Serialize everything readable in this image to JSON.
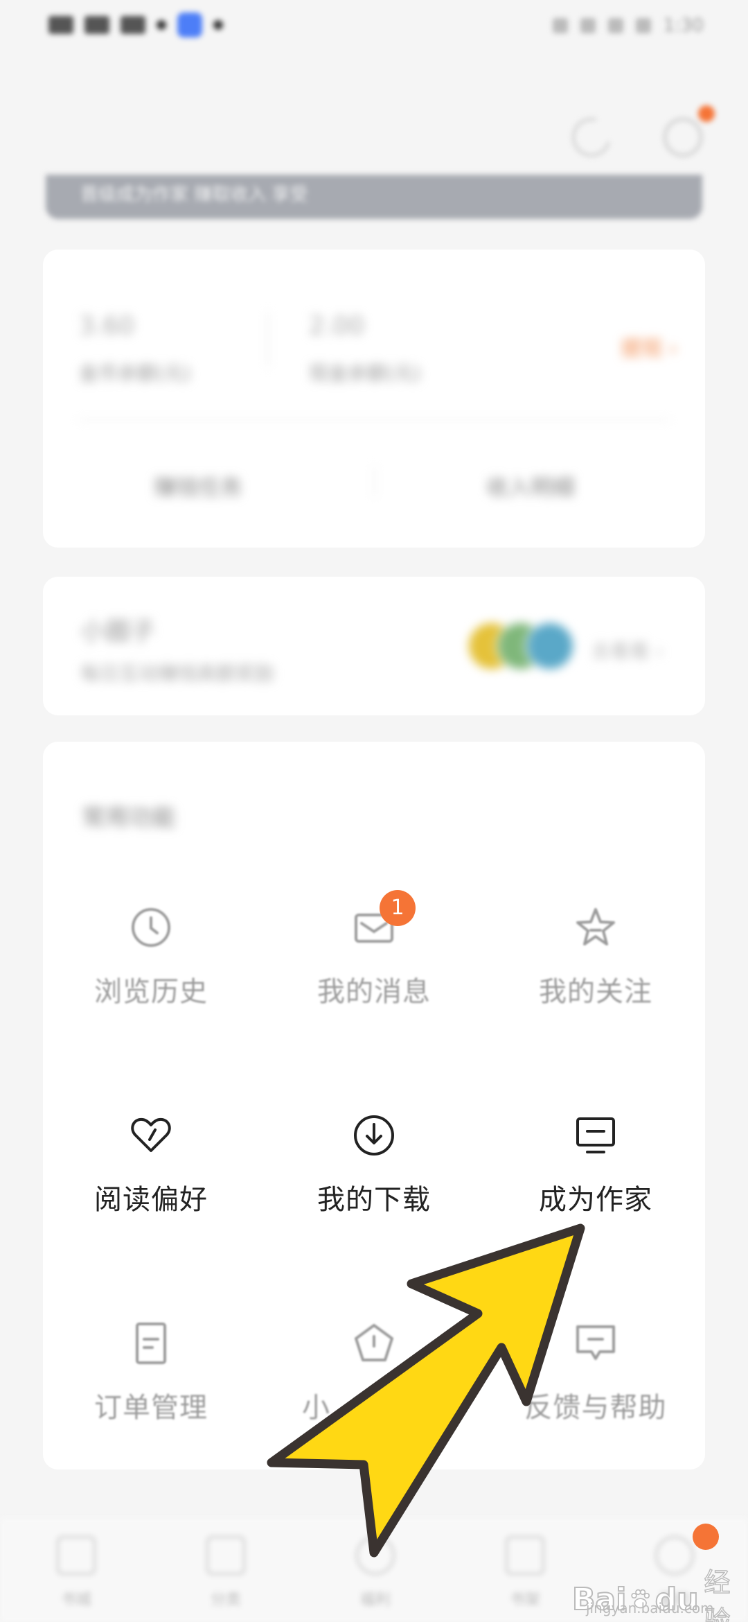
{
  "status_bar": {
    "time": "1:30"
  },
  "banner": {
    "text": "晋级成为作家 赚取收入 享受"
  },
  "wallet": {
    "left_value": "3.60",
    "left_label": "金币余额(元)",
    "right_value": "2.00",
    "right_label": "现金余额(元)",
    "link": "提现 ›",
    "action_left": "赚钱任务",
    "action_right": "收入明细"
  },
  "circle": {
    "title": "小圈子",
    "desc": "每日互动赚钱高额奖励",
    "more": "去看看 ›"
  },
  "services": {
    "title": "常用功能",
    "items": [
      {
        "label": "浏览历史",
        "icon": "clock-icon"
      },
      {
        "label": "我的消息",
        "icon": "envelope-icon",
        "badge": "1"
      },
      {
        "label": "我的关注",
        "icon": "star-icon"
      },
      {
        "label": "阅读偏好",
        "icon": "heart-icon"
      },
      {
        "label": "我的下载",
        "icon": "download-icon"
      },
      {
        "label": "成为作家",
        "icon": "monitor-icon"
      },
      {
        "label": "订单管理",
        "icon": "document-icon"
      },
      {
        "label": "小",
        "icon": "pentagon-icon"
      },
      {
        "label": "反馈与帮助",
        "icon": "chat-icon"
      }
    ]
  },
  "bottom_nav": {
    "items": [
      {
        "label": "书城",
        "icon": "home-icon"
      },
      {
        "label": "分类",
        "icon": "grid-icon"
      },
      {
        "label": "福利",
        "icon": "gift-icon"
      },
      {
        "label": "书架",
        "icon": "book-icon"
      },
      {
        "label": "我的",
        "icon": "user-icon"
      }
    ]
  },
  "watermark": {
    "brand": "Bai",
    "brand2": "du",
    "text": "经验",
    "url": "jingyan.baidu.com"
  },
  "colors": {
    "accent": "#f57436",
    "arrow_fill": "#ffd814",
    "arrow_stroke": "#3a3330"
  }
}
